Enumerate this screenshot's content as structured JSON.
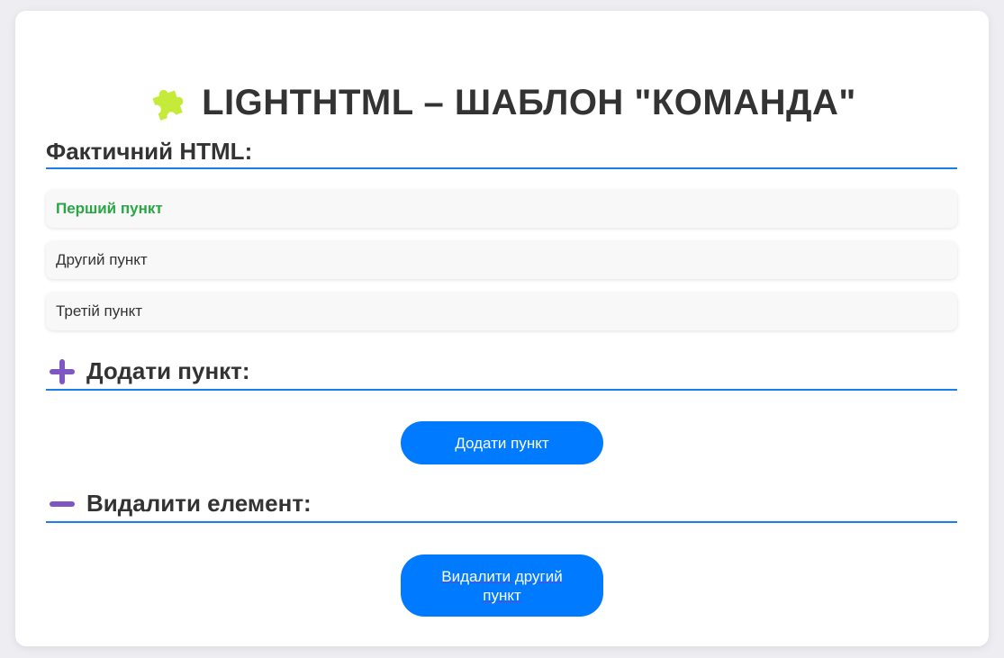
{
  "title": "LIGHTHTML – ШАБЛОН \"КОМАНДА\"",
  "icons": {
    "title": "puzzle-piece-icon",
    "add_section": "plus-icon",
    "remove_section": "minus-icon"
  },
  "colors": {
    "accent": "#007bff",
    "divider": "#1a7fe8",
    "active_item": "#28a745",
    "puzzle": "#c6ea3a",
    "section_icon": "#7e57c2"
  },
  "sections": {
    "actual_html": "Фактичний HTML:",
    "add_item": "Додати пункт:",
    "remove_item": "Видалити елемент:"
  },
  "list": {
    "items": [
      {
        "label": "Перший пункт",
        "active": true
      },
      {
        "label": "Другий пункт",
        "active": false
      },
      {
        "label": "Третій пункт",
        "active": false
      }
    ]
  },
  "buttons": {
    "add_label": "Додати пункт",
    "remove_label": "Видалити другий пункт"
  }
}
